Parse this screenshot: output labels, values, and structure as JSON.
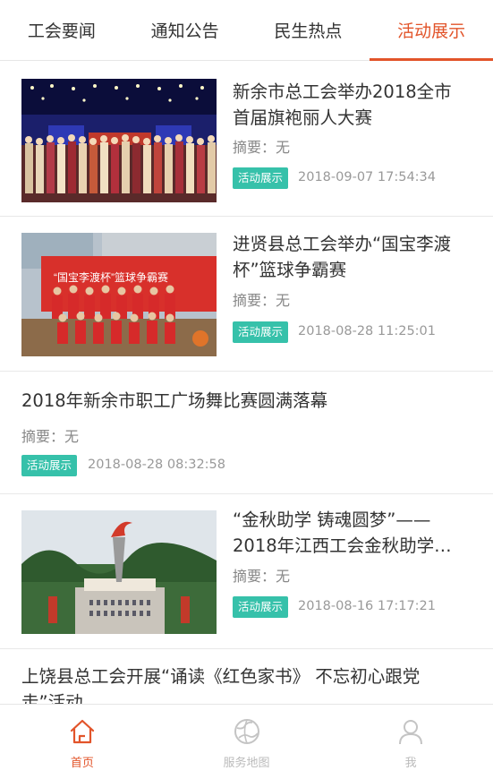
{
  "tabs": [
    {
      "label": "工会要闻",
      "active": false
    },
    {
      "label": "通知公告",
      "active": false
    },
    {
      "label": "民生热点",
      "active": false
    },
    {
      "label": "活动展示",
      "active": true
    }
  ],
  "articles": [
    {
      "title_line1": "新余市总工会举办2018全市",
      "title_line2": "首届旗袍丽人大赛",
      "summary": "摘要：无",
      "tag": "活动展示",
      "date": "2018-09-07 17:54:34",
      "image": "stage-group-photo"
    },
    {
      "title_line1": "进贤县总工会举办“国宝李渡",
      "title_line2": "杯”篮球争霸赛",
      "summary": "摘要：无",
      "tag": "活动展示",
      "date": "2018-08-28 11:25:01",
      "image": "basketball-team-photo",
      "image_banner_text": "“国宝李渡杯”篮球争霸赛"
    },
    {
      "title_line1": "2018年新余市职工广场舞比赛圆满落幕",
      "summary": "摘要：无",
      "tag": "活动展示",
      "date": "2018-08-28 08:32:58"
    },
    {
      "title_line1": "“金秋助学 铸魂圆梦”——",
      "title_line2": "2018年江西工会金秋助学…",
      "summary": "摘要：无",
      "tag": "活动展示",
      "date": "2018-08-16 17:17:21",
      "image": "torch-monument-photo"
    },
    {
      "title_line1": "上饶县总工会开展“诵读《红色家书》 不忘初心跟党",
      "title_line2": "走”活动"
    }
  ],
  "bottom_nav": [
    {
      "label": "首页",
      "icon": "home-icon",
      "active": true
    },
    {
      "label": "服务地图",
      "icon": "map-globe-icon",
      "active": false
    },
    {
      "label": "我",
      "icon": "user-icon",
      "active": false
    }
  ],
  "colors": {
    "accent": "#e2542a",
    "tag_bg": "#36c1aa",
    "inactive_nav": "#bbbbbb"
  }
}
